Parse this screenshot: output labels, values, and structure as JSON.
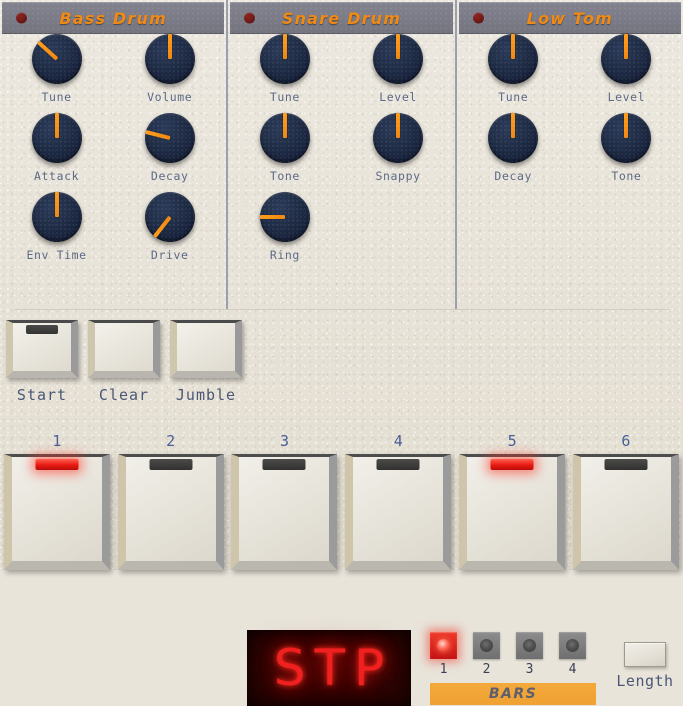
{
  "voices": [
    {
      "title": "Bass Drum",
      "led": "record-led",
      "knobs": [
        {
          "label": "Tune",
          "angle": -48
        },
        {
          "label": "Volume",
          "angle": 0
        },
        {
          "label": "Attack",
          "angle": 0
        },
        {
          "label": "Decay",
          "angle": -76
        },
        {
          "label": "Env Time",
          "angle": 0
        },
        {
          "label": "Drive",
          "angle": -142
        }
      ]
    },
    {
      "title": "Snare Drum",
      "led": "record-led",
      "knobs": [
        {
          "label": "Tone",
          "angle": 0
        },
        {
          "label": "Snappy",
          "angle": 0
        },
        {
          "label": "Ring",
          "angle": -90
        },
        {
          "label": "",
          "angle": 0
        }
      ],
      "top_knobs": [
        {
          "label": "Tune",
          "angle": 0
        },
        {
          "label": "Level",
          "angle": 0
        }
      ]
    },
    {
      "title": "Low Tom",
      "led": "record-led",
      "knobs": [
        {
          "label": "Decay",
          "angle": 0
        },
        {
          "label": "Tone",
          "angle": 0
        }
      ]
    }
  ],
  "voice_rows": {
    "bass": [
      [
        {
          "label": "Tune",
          "angle": -48
        },
        {
          "label": "Volume",
          "angle": 0
        }
      ],
      [
        {
          "label": "Attack",
          "angle": 0
        },
        {
          "label": "Decay",
          "angle": -76
        }
      ],
      [
        {
          "label": "Env Time",
          "angle": 0
        },
        {
          "label": "Drive",
          "angle": -142
        }
      ]
    ],
    "snare": [
      [
        {
          "label": "Tune",
          "angle": 0
        },
        {
          "label": "Level",
          "angle": 0
        }
      ],
      [
        {
          "label": "Tone",
          "angle": 0
        },
        {
          "label": "Snappy",
          "angle": 0
        }
      ],
      [
        {
          "label": "Ring",
          "angle": -90
        },
        {
          "label": "",
          "angle": 0,
          "empty": true
        }
      ]
    ],
    "lowtom": [
      [
        {
          "label": "Tune",
          "angle": 0
        },
        {
          "label": "Level",
          "angle": 0
        }
      ],
      [
        {
          "label": "Decay",
          "angle": 0
        },
        {
          "label": "Tone",
          "angle": 0
        }
      ],
      [
        {
          "label": "",
          "angle": 0,
          "empty": true
        },
        {
          "label": "",
          "angle": 0,
          "empty": true
        }
      ]
    ]
  },
  "transport": {
    "buttons": [
      {
        "label": "Start",
        "led_on": false
      },
      {
        "label": "Clear",
        "led_on": false
      },
      {
        "label": "Jumble",
        "led_on": false
      }
    ],
    "display_value": "STP",
    "bars_label": "BARS",
    "bar_leds": [
      {
        "number": "1",
        "on": true
      },
      {
        "number": "2",
        "on": false
      },
      {
        "number": "3",
        "on": false
      },
      {
        "number": "4",
        "on": false
      }
    ],
    "length_label": "Length"
  },
  "steps": [
    {
      "number": "1",
      "on": true
    },
    {
      "number": "2",
      "on": false
    },
    {
      "number": "3",
      "on": false
    },
    {
      "number": "4",
      "on": false
    },
    {
      "number": "5",
      "on": true
    },
    {
      "number": "6",
      "on": false
    }
  ],
  "colors": {
    "accent_orange": "#f08a14",
    "led_red": "#e81a12",
    "knob_navy": "#1f2c45",
    "panel_gray": "#7c7c88",
    "bars_orange": "#f4a93c",
    "label_blue": "#5c6a86"
  }
}
